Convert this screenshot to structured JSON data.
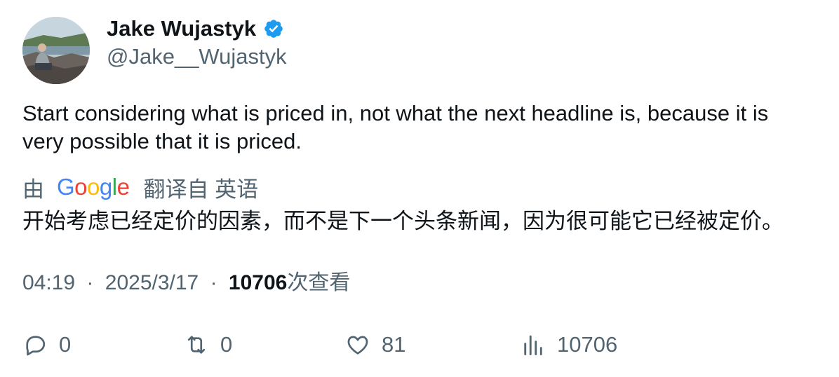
{
  "author": {
    "display_name": "Jake Wujastyk",
    "handle": "@Jake__Wujastyk",
    "avatar_icon": "user-photo",
    "verified_icon": "verified-badge-icon",
    "verified_color": "#1d9bf0"
  },
  "tweet": {
    "text": "Start considering what is priced in, not what the next headline is, because it is very possible that it is priced."
  },
  "translation": {
    "by_label": "由",
    "provider_logo_text": "Google",
    "from_label": "翻译自 英语",
    "text": "开始考虑已经定价的因素，而不是下一个头条新闻，因为很可能它已经被定价。"
  },
  "meta": {
    "time": "04:19",
    "separator": "·",
    "date": "2025/3/17",
    "views_count": "10706",
    "views_label": "次查看"
  },
  "actions": {
    "reply": {
      "icon": "reply-icon",
      "count": "0"
    },
    "retweet": {
      "icon": "retweet-icon",
      "count": "0"
    },
    "like": {
      "icon": "heart-icon",
      "count": "81"
    },
    "views": {
      "icon": "views-chart-icon",
      "count": "10706"
    }
  },
  "colors": {
    "text_primary": "#0f1419",
    "text_secondary": "#536471",
    "google_blue": "#4285f4",
    "google_red": "#ea4335",
    "google_yellow": "#fbbc05",
    "google_green": "#34a853"
  }
}
